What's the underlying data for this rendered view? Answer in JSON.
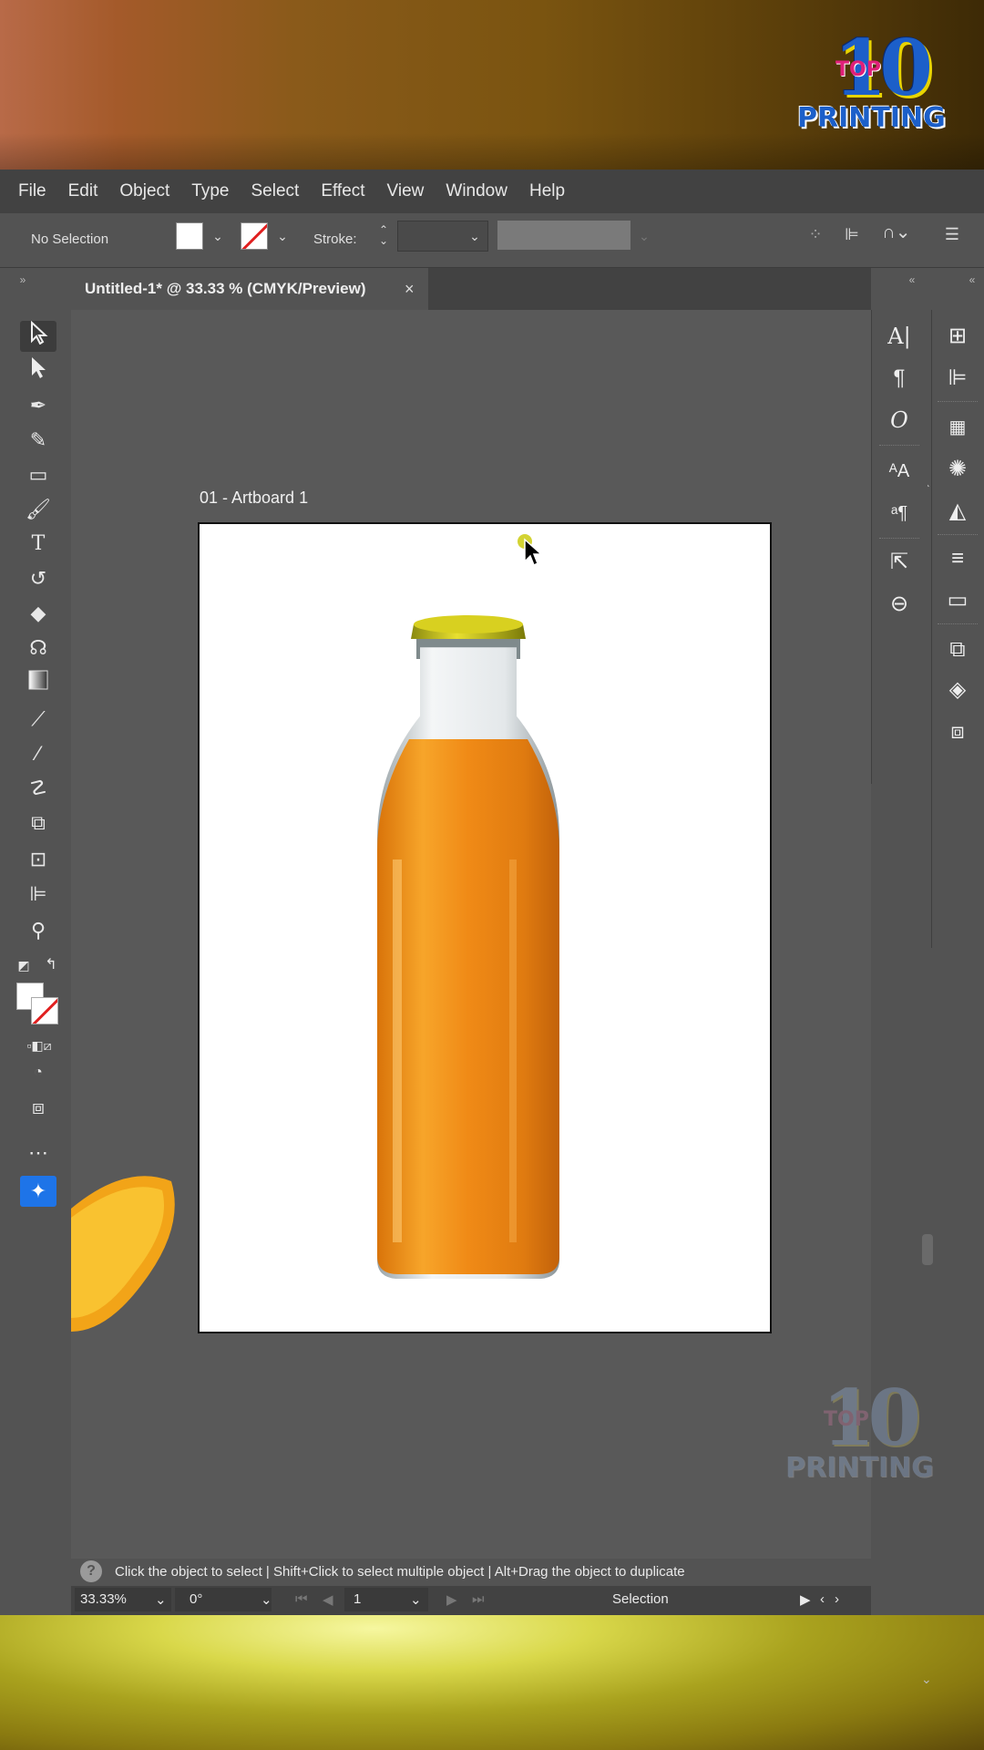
{
  "colors": {
    "accent": "#1e74e8",
    "app_bg": "#535353",
    "menubar_bg": "#424242",
    "canvas_bg": "#595959"
  },
  "logo": {
    "number": "10",
    "top_word": "TOP",
    "printing": "PRINTING"
  },
  "menu": {
    "items": [
      "File",
      "Edit",
      "Object",
      "Type",
      "Select",
      "Effect",
      "View",
      "Window",
      "Help"
    ]
  },
  "control_bar": {
    "selection": "No Selection",
    "stroke_label": "Stroke:"
  },
  "document": {
    "tab_title": "Untitled-1* @ 33.33 % (CMYK/Preview)",
    "close": "×",
    "artboard_label": "01 - Artboard 1"
  },
  "tools": [
    "selection-tool",
    "direct-selection-tool",
    "pen-tool",
    "curvature-tool",
    "rectangle-tool",
    "paintbrush-tool",
    "type-tool",
    "rotate-tool",
    "eraser-tool",
    "lasso-tool",
    "gradient-tool",
    "eyedropper-tool",
    "blend-tool",
    "puppet-warp-tool",
    "shape-builder-tool",
    "artboard-tool",
    "align-tool",
    "zoom-tool"
  ],
  "status": {
    "hint": "Click the object to select  |  Shift+Click to select multiple object  |  Alt+Drag the object to duplicate"
  },
  "bottom_bar": {
    "zoom": "33.33%",
    "rotation": "0°",
    "artboard_number": "1",
    "mode": "Selection"
  }
}
